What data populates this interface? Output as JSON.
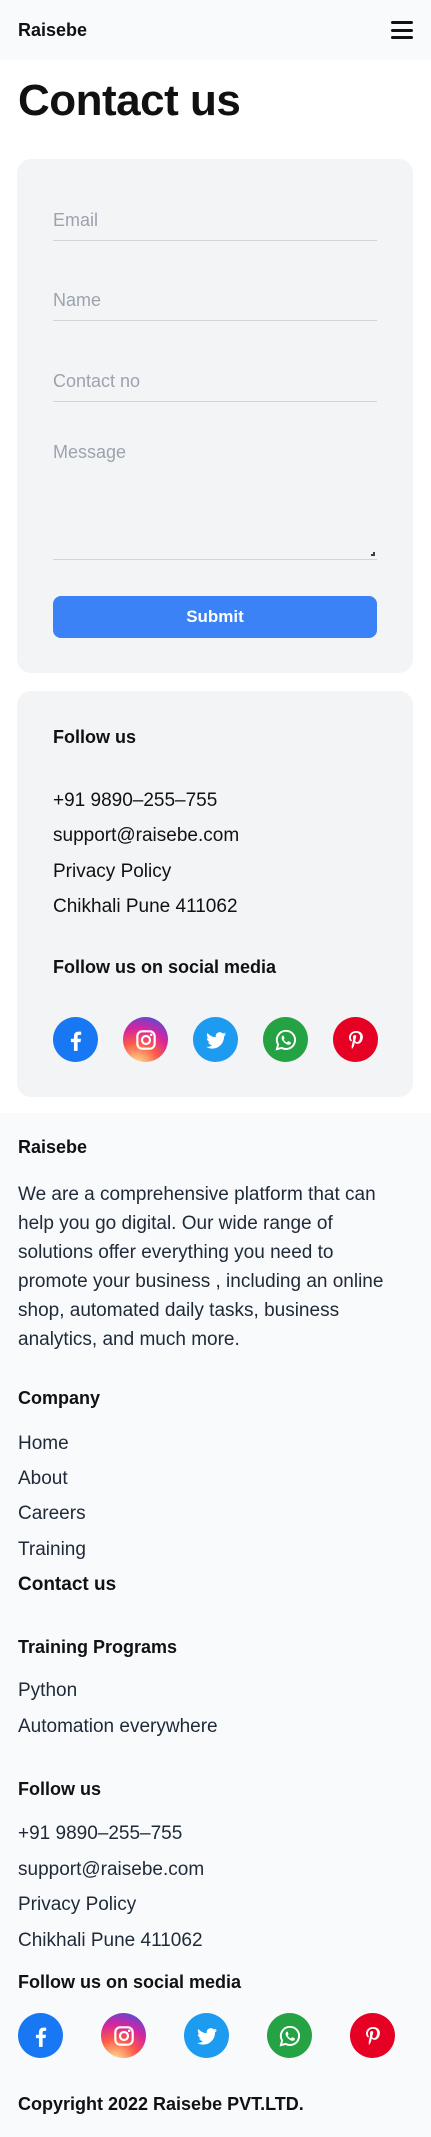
{
  "header": {
    "brand": "Raisebe"
  },
  "page": {
    "title": "Contact us"
  },
  "form": {
    "email_placeholder": "Email",
    "name_placeholder": "Name",
    "contact_placeholder": "Contact no",
    "message_placeholder": "Message",
    "submit_label": "Submit"
  },
  "follow_card": {
    "heading": "Follow us",
    "phone": "+91 9890–255–755",
    "email": "support@raisebe.com",
    "privacy": "Privacy Policy",
    "address": "Chikhali Pune 411062",
    "social_heading": "Follow us on social media"
  },
  "social_icons": [
    "facebook-icon",
    "instagram-icon",
    "twitter-icon",
    "whatsapp-icon",
    "pinterest-icon"
  ],
  "colors": {
    "accent": "#3b82f6",
    "facebook": "#1877f2",
    "twitter": "#1d9bf0",
    "whatsapp": "#25a244",
    "pinterest": "#e60023"
  },
  "footer": {
    "brand": "Raisebe",
    "about": "We are a comprehensive platform that can help you go digital. Our wide range of solutions offer everything you need to promote your business , including an online shop, automated daily tasks, business analytics, and much more.",
    "company_heading": "Company",
    "company_links": [
      "Home",
      "About",
      "Careers",
      "Training",
      "Contact us"
    ],
    "training_heading": "Training Programs",
    "training_links": [
      "Python",
      "Automation everywhere"
    ],
    "follow_heading": "Follow us",
    "phone": "+91 9890–255–755",
    "email": "support@raisebe.com",
    "privacy": "Privacy Policy",
    "address": "Chikhali Pune 411062",
    "social_heading": "Follow us on social media",
    "copyright": "Copyright 2022 Raisebe PVT.LTD."
  }
}
